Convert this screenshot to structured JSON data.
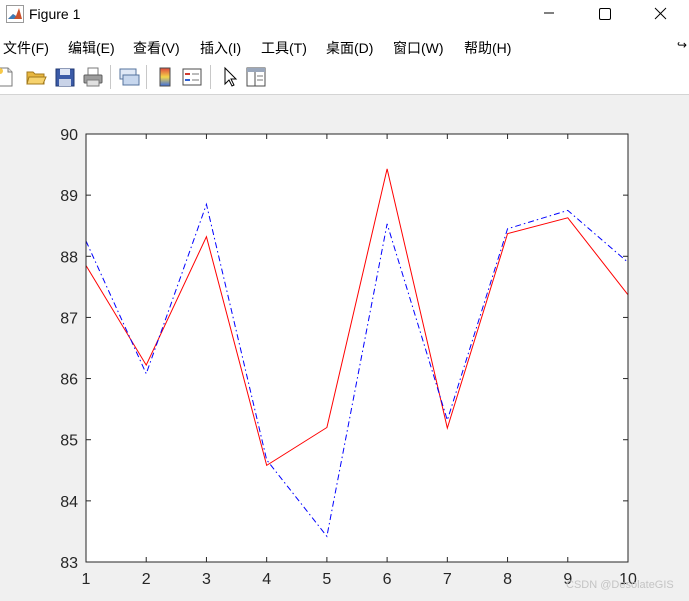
{
  "window": {
    "title": "Figure 1",
    "app_icon": "matlab-logo-icon",
    "controls": [
      "minimize-icon",
      "maximize-icon",
      "close-icon"
    ]
  },
  "menu": {
    "items": [
      "文件(F)",
      "编辑(E)",
      "查看(V)",
      "插入(I)",
      "工具(T)",
      "桌面(D)",
      "窗口(W)",
      "帮助(H)"
    ],
    "overflow_icon": "dock-arrow-icon"
  },
  "toolbar": {
    "icons": [
      "new-figure-icon",
      "open-file-icon",
      "save-icon",
      "print-icon",
      "link-plot-icon",
      "insert-colorbar-icon",
      "insert-legend-icon",
      "select-arrow-icon",
      "property-inspector-icon"
    ]
  },
  "chart_data": {
    "type": "line",
    "x": [
      1,
      2,
      3,
      4,
      5,
      6,
      7,
      8,
      9,
      10
    ],
    "xlim": [
      1,
      10
    ],
    "ylim": [
      83,
      90
    ],
    "xticks": [
      "1",
      "2",
      "3",
      "4",
      "5",
      "6",
      "7",
      "8",
      "9",
      "10"
    ],
    "yticks": [
      "83",
      "84",
      "85",
      "86",
      "87",
      "88",
      "89",
      "90"
    ],
    "grid": false,
    "series": [
      {
        "style": "solid",
        "color": "#ff0000",
        "values": [
          87.85,
          86.22,
          88.32,
          84.58,
          85.2,
          89.43,
          85.19,
          88.37,
          88.63,
          87.37
        ]
      },
      {
        "style": "dash-dot",
        "color": "#0000ff",
        "values": [
          88.25,
          86.08,
          88.85,
          84.67,
          83.42,
          88.53,
          85.32,
          88.45,
          88.75,
          87.9
        ]
      }
    ]
  },
  "watermark": "CSDN @DesolateGIS"
}
